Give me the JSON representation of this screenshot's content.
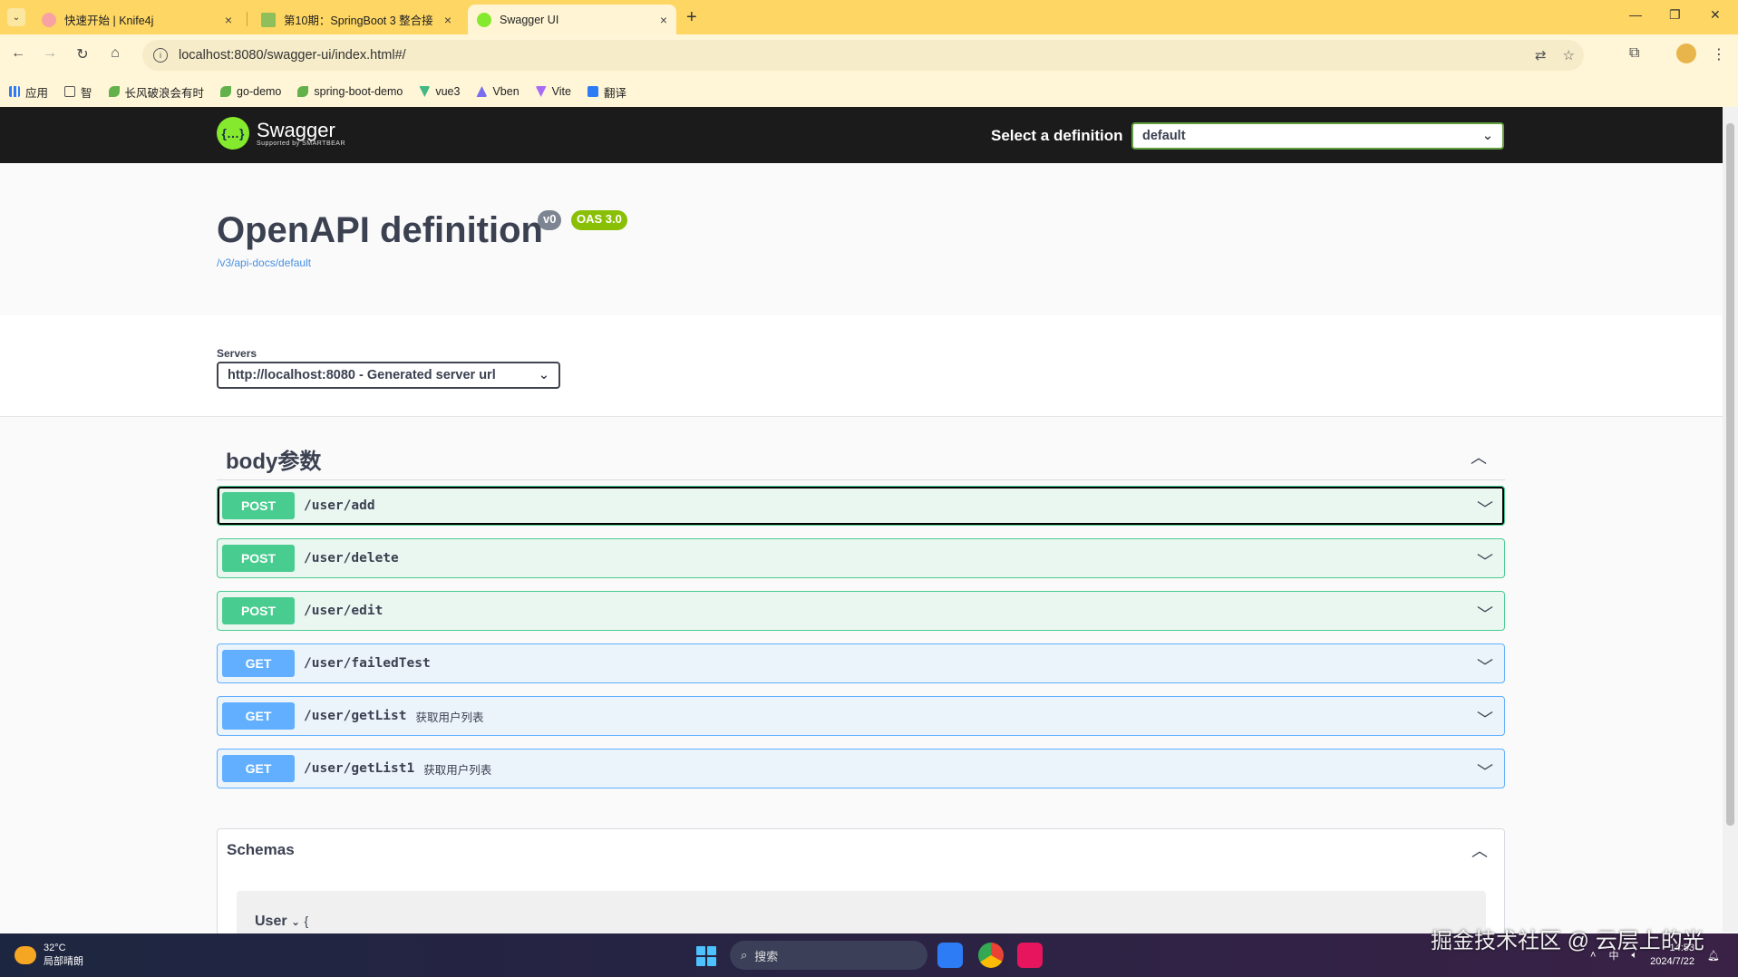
{
  "browser": {
    "tabs": [
      {
        "label": "快速开始 | Knife4j",
        "fav_color": "#f7a3a3",
        "active": false
      },
      {
        "label": "第10期：SpringBoot 3 整合接",
        "fav_color": "#8fbf5a",
        "active": false
      },
      {
        "label": "Swagger UI",
        "fav_color": "#85ea2d",
        "active": true
      }
    ],
    "new_tab": "+",
    "close_glyph": "×",
    "address_url": "localhost:8080/swagger-ui/index.html#/",
    "bookmarks": [
      {
        "label": "应用",
        "color": "#555"
      },
      {
        "label": "智",
        "color": "#777"
      },
      {
        "label": "长风破浪会有时",
        "color": "#62b14b"
      },
      {
        "label": "go-demo",
        "color": "#62b14b"
      },
      {
        "label": "spring-boot-demo",
        "color": "#62b14b"
      },
      {
        "label": "vue3",
        "color": "#42b883"
      },
      {
        "label": "Vben",
        "color": "#7a6cf0"
      },
      {
        "label": "Vite",
        "color": "#a86bf5"
      },
      {
        "label": "翻译",
        "color": "#2d7cf6"
      }
    ]
  },
  "swagger": {
    "logo_text": "Swagger",
    "logo_sub": "Supported by SMARTBEAR",
    "definition_label": "Select a definition",
    "definition_value": "default",
    "info": {
      "title": "OpenAPI definition",
      "version_badge": "v0",
      "oas_badge": "OAS 3.0",
      "link": "/v3/api-docs/default"
    },
    "servers": {
      "label": "Servers",
      "selected": "http://localhost:8080 - Generated server url"
    },
    "tag": {
      "name": "body参数",
      "operations": [
        {
          "method": "POST",
          "path": "/user/add",
          "summary": ""
        },
        {
          "method": "POST",
          "path": "/user/delete",
          "summary": ""
        },
        {
          "method": "POST",
          "path": "/user/edit",
          "summary": ""
        },
        {
          "method": "GET",
          "path": "/user/failedTest",
          "summary": ""
        },
        {
          "method": "GET",
          "path": "/user/getList",
          "summary": "获取用户列表"
        },
        {
          "method": "GET",
          "path": "/user/getList1",
          "summary": "获取用户列表"
        }
      ]
    },
    "schemas": {
      "title": "Schemas",
      "models": [
        {
          "name": "User",
          "brace": "{"
        }
      ]
    }
  },
  "taskbar": {
    "weather_temp": "32°C",
    "weather_desc": "局部晴朗",
    "search_placeholder": "搜索",
    "ime": "中",
    "time": "14:53",
    "date": "2024/7/22"
  },
  "watermark": "掘金技术社区 @ 云层上的光"
}
